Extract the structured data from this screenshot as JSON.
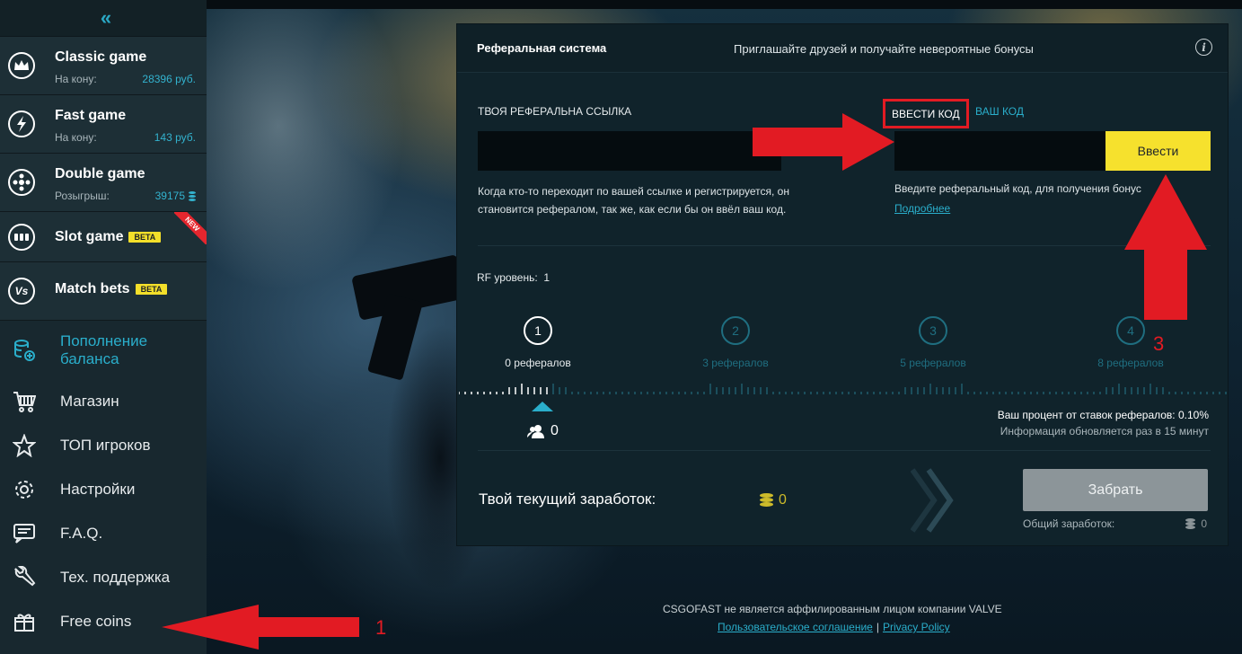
{
  "sidebar": {
    "collapse_icon": "double-chevron-left-icon",
    "games": [
      {
        "title": "Classic game",
        "sub_label": "На кону:",
        "sub_value": "28396 руб.",
        "icon": "crown-icon"
      },
      {
        "title": "Fast game",
        "sub_label": "На кону:",
        "sub_value": "143 руб.",
        "icon": "lightning-icon"
      },
      {
        "title": "Double game",
        "sub_label": "Розыгрыш:",
        "sub_value": "39175",
        "icon": "fan-icon"
      },
      {
        "title": "Slot game",
        "badge": "BETA",
        "ribbon": "NEW",
        "icon": "slot-icon"
      },
      {
        "title": "Match bets",
        "badge": "BETA",
        "icon": "vs-icon"
      }
    ],
    "menu": [
      {
        "label": "Пополнение баланса",
        "icon": "coins-plus-icon"
      },
      {
        "label": "Магазин",
        "icon": "cart-icon"
      },
      {
        "label": "ТОП игроков",
        "icon": "star-icon"
      },
      {
        "label": "Настройки",
        "icon": "gear-icon"
      },
      {
        "label": "F.A.Q.",
        "icon": "faq-icon"
      },
      {
        "label": "Тех. поддержка",
        "icon": "wrench-icon"
      },
      {
        "label": "Free coins",
        "icon": "gift-icon"
      }
    ]
  },
  "modal": {
    "title": "Реферальная система",
    "subtitle": "Приглашайте друзей и получайте невероятные бонусы",
    "info_icon": "info-icon",
    "ref_link_label": "ТВОЯ РЕФЕРАЛЬНА ССЫЛКА",
    "ref_link_value": "",
    "ref_desc": "Когда кто-то переходит по вашей ссылке и регистрируется, он становится рефералом, так же, как если бы он ввёл ваш код.",
    "tab_enter_code": "ВВЕСТИ КОД",
    "tab_your_code": "ВАШ КОД",
    "code_input_value": "",
    "enter_button": "Ввести",
    "code_desc": "Введите реферальный код, для получения бонус",
    "more_link": "Подробнее",
    "rf_level_label": "RF уровень:",
    "rf_level_value": "1",
    "steps": [
      {
        "num": "1",
        "label": "0 рефералов"
      },
      {
        "num": "2",
        "label": "3 рефералов"
      },
      {
        "num": "3",
        "label": "5 рефералов"
      },
      {
        "num": "4",
        "label": "8 рефералов"
      }
    ],
    "active_step": 1,
    "referral_count": "0",
    "percent_text": "Ваш процент от ставок рефералов: 0.10%",
    "update_text": "Информация обновляется раз в 15 минут",
    "earnings_label": "Твой текущий заработок:",
    "earnings_value": "0",
    "take_button": "Забрать",
    "total_label": "Общий заработок:",
    "total_value": "0"
  },
  "footer": {
    "disclaimer": "CSGOFAST не является аффилированным лицом компании VALVE",
    "terms_link": "Пользовательское соглашение",
    "separator": "|",
    "privacy_link": "Privacy Policy"
  },
  "annotations": {
    "num1": "1",
    "num3": "3",
    "color": "#e21b23"
  },
  "colors": {
    "accent": "#2aaecb",
    "yellow": "#f6e12d",
    "sidebar_bg": "#18282f",
    "modal_bg": "#10232b"
  }
}
